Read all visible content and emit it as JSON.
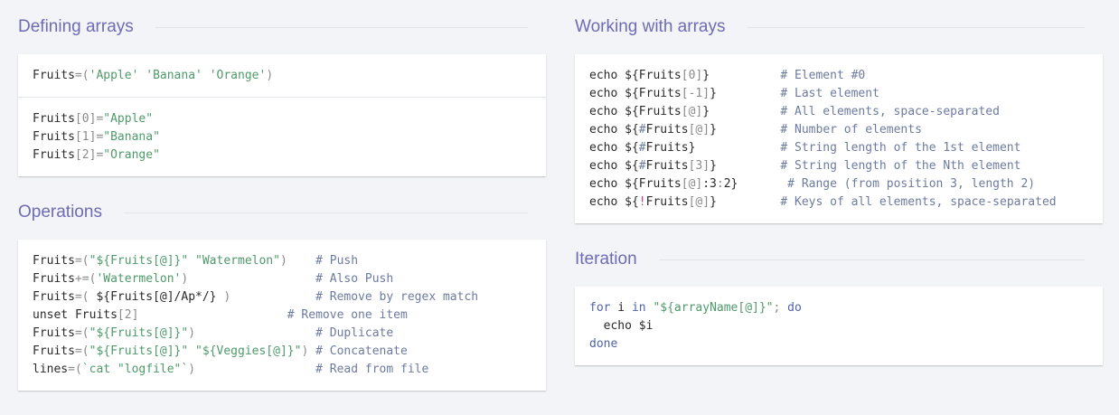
{
  "sections": {
    "defining_arrays": {
      "title": "Defining arrays",
      "blocks": [
        {
          "lines": [
            [
              [
                "t",
                "Fruits"
              ],
              [
                "p",
                "=("
              ],
              [
                "s",
                "'Apple'"
              ],
              [
                "t",
                " "
              ],
              [
                "s",
                "'Banana'"
              ],
              [
                "t",
                " "
              ],
              [
                "s",
                "'Orange'"
              ],
              [
                "p",
                ")"
              ]
            ]
          ]
        },
        {
          "lines": [
            [
              [
                "t",
                "Fruits"
              ],
              [
                "p",
                "[0]="
              ],
              [
                "s",
                "\"Apple\""
              ]
            ],
            [
              [
                "t",
                "Fruits"
              ],
              [
                "p",
                "[1]="
              ],
              [
                "s",
                "\"Banana\""
              ]
            ],
            [
              [
                "t",
                "Fruits"
              ],
              [
                "p",
                "[2]="
              ],
              [
                "s",
                "\"Orange\""
              ]
            ]
          ]
        }
      ]
    },
    "operations": {
      "title": "Operations",
      "blocks": [
        {
          "lines": [
            [
              [
                "t",
                "Fruits"
              ],
              [
                "p",
                "=("
              ],
              [
                "s",
                "\"${Fruits[@]}\""
              ],
              [
                "t",
                " "
              ],
              [
                "s",
                "\"Watermelon\""
              ],
              [
                "p",
                ")"
              ],
              [
                "t",
                "    "
              ],
              [
                "c",
                "# Push"
              ]
            ],
            [
              [
                "t",
                "Fruits"
              ],
              [
                "p",
                "+=("
              ],
              [
                "s",
                "'Watermelon'"
              ],
              [
                "p",
                ")"
              ],
              [
                "t",
                "                  "
              ],
              [
                "c",
                "# Also Push"
              ]
            ],
            [
              [
                "t",
                "Fruits"
              ],
              [
                "p",
                "=("
              ],
              [
                "t",
                " ${Fruits[@]/Ap*/} "
              ],
              [
                "p",
                ")"
              ],
              [
                "t",
                "            "
              ],
              [
                "c",
                "# Remove by regex match"
              ]
            ],
            [
              [
                "t",
                "unset Fruits"
              ],
              [
                "p",
                "[2]"
              ],
              [
                "t",
                "                     "
              ],
              [
                "c",
                "# Remove one item"
              ]
            ],
            [
              [
                "t",
                "Fruits"
              ],
              [
                "p",
                "=("
              ],
              [
                "s",
                "\"${Fruits[@]}\""
              ],
              [
                "p",
                ")"
              ],
              [
                "t",
                "                 "
              ],
              [
                "c",
                "# Duplicate"
              ]
            ],
            [
              [
                "t",
                "Fruits"
              ],
              [
                "p",
                "=("
              ],
              [
                "s",
                "\"${Fruits[@]}\""
              ],
              [
                "t",
                " "
              ],
              [
                "s",
                "\"${Veggies[@]}\""
              ],
              [
                "p",
                ")"
              ],
              [
                "t",
                " "
              ],
              [
                "c",
                "# Concatenate"
              ]
            ],
            [
              [
                "t",
                "lines"
              ],
              [
                "p",
                "=("
              ],
              [
                "s",
                "`cat \"logfile\"`"
              ],
              [
                "p",
                ")"
              ],
              [
                "t",
                "                 "
              ],
              [
                "c",
                "# Read from file"
              ]
            ]
          ]
        }
      ]
    },
    "working_with_arrays": {
      "title": "Working with arrays",
      "blocks": [
        {
          "lines": [
            [
              [
                "t",
                "echo ${Fruits"
              ],
              [
                "p",
                "[0]"
              ],
              [
                "t",
                "}          "
              ],
              [
                "c",
                "# Element #0"
              ]
            ],
            [
              [
                "t",
                "echo ${Fruits"
              ],
              [
                "p",
                "[-1]"
              ],
              [
                "t",
                "}         "
              ],
              [
                "c",
                "# Last element"
              ]
            ],
            [
              [
                "t",
                "echo ${Fruits"
              ],
              [
                "p",
                "[@]"
              ],
              [
                "t",
                "}          "
              ],
              [
                "c",
                "# All elements, space-separated"
              ]
            ],
            [
              [
                "t",
                "echo ${"
              ],
              [
                "c",
                "#"
              ],
              [
                "t",
                "Fruits"
              ],
              [
                "p",
                "[@]"
              ],
              [
                "t",
                "}         "
              ],
              [
                "c",
                "# Number of elements"
              ]
            ],
            [
              [
                "t",
                "echo ${"
              ],
              [
                "c",
                "#"
              ],
              [
                "t",
                "Fruits}            "
              ],
              [
                "c",
                "# String length of the 1st element"
              ]
            ],
            [
              [
                "t",
                "echo ${"
              ],
              [
                "c",
                "#"
              ],
              [
                "t",
                "Fruits"
              ],
              [
                "p",
                "[3]"
              ],
              [
                "t",
                "}         "
              ],
              [
                "c",
                "# String length of the Nth element"
              ]
            ],
            [
              [
                "t",
                "echo ${Fruits"
              ],
              [
                "p",
                "[@]"
              ],
              [
                "t",
                ":3"
              ],
              [
                "p",
                ":"
              ],
              [
                "t",
                "2}       "
              ],
              [
                "c",
                "# Range (from position 3, length 2)"
              ]
            ],
            [
              [
                "t",
                "echo ${"
              ],
              [
                "o",
                "!"
              ],
              [
                "t",
                "Fruits"
              ],
              [
                "p",
                "[@]"
              ],
              [
                "t",
                "}         "
              ],
              [
                "c",
                "# Keys of all elements, space-separated"
              ]
            ]
          ]
        }
      ]
    },
    "iteration": {
      "title": "Iteration",
      "blocks": [
        {
          "lines": [
            [
              [
                "k",
                "for"
              ],
              [
                "t",
                " i "
              ],
              [
                "k",
                "in"
              ],
              [
                "t",
                " "
              ],
              [
                "s",
                "\"${arrayName[@]}\""
              ],
              [
                "p",
                ";"
              ],
              [
                "t",
                " "
              ],
              [
                "k",
                "do"
              ]
            ],
            [
              [
                "t",
                "  echo $i"
              ]
            ],
            [
              [
                "k",
                "done"
              ]
            ]
          ]
        }
      ]
    }
  }
}
